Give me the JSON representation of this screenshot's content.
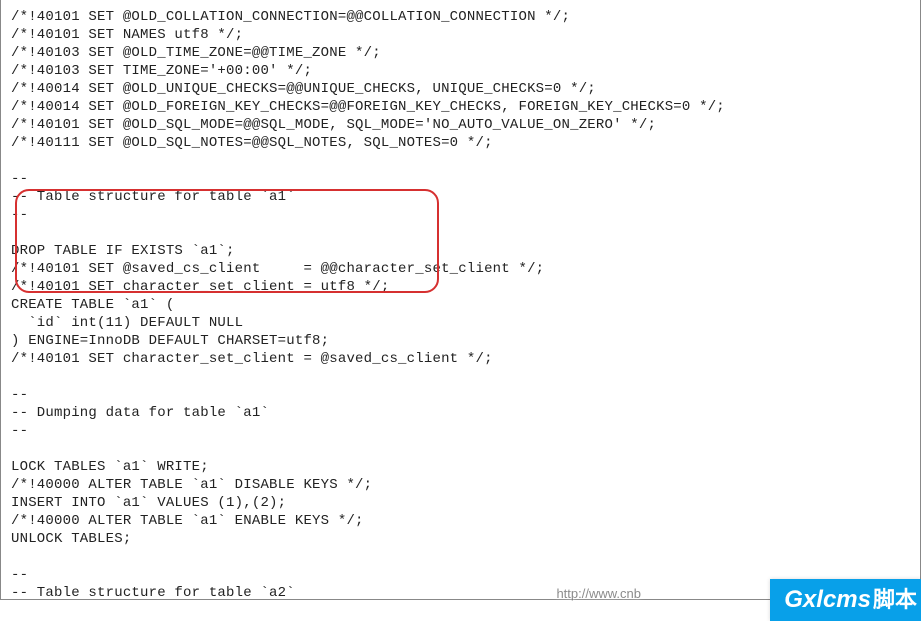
{
  "code_lines": [
    "/*!40101 SET @OLD_COLLATION_CONNECTION=@@COLLATION_CONNECTION */;",
    "/*!40101 SET NAMES utf8 */;",
    "/*!40103 SET @OLD_TIME_ZONE=@@TIME_ZONE */;",
    "/*!40103 SET TIME_ZONE='+00:00' */;",
    "/*!40014 SET @OLD_UNIQUE_CHECKS=@@UNIQUE_CHECKS, UNIQUE_CHECKS=0 */;",
    "/*!40014 SET @OLD_FOREIGN_KEY_CHECKS=@@FOREIGN_KEY_CHECKS, FOREIGN_KEY_CHECKS=0 */;",
    "/*!40101 SET @OLD_SQL_MODE=@@SQL_MODE, SQL_MODE='NO_AUTO_VALUE_ON_ZERO' */;",
    "/*!40111 SET @OLD_SQL_NOTES=@@SQL_NOTES, SQL_NOTES=0 */;",
    "",
    "--",
    "-- Table structure for table `a1`",
    "--",
    "",
    "DROP TABLE IF EXISTS `a1`;",
    "/*!40101 SET @saved_cs_client     = @@character_set_client */;",
    "/*!40101 SET character_set_client = utf8 */;",
    "CREATE TABLE `a1` (",
    "  `id` int(11) DEFAULT NULL",
    ") ENGINE=InnoDB DEFAULT CHARSET=utf8;",
    "/*!40101 SET character_set_client = @saved_cs_client */;",
    "",
    "--",
    "-- Dumping data for table `a1`",
    "--",
    "",
    "LOCK TABLES `a1` WRITE;",
    "/*!40000 ALTER TABLE `a1` DISABLE KEYS */;",
    "INSERT INTO `a1` VALUES (1),(2);",
    "/*!40000 ALTER TABLE `a1` ENABLE KEYS */;",
    "UNLOCK TABLES;",
    "",
    "--",
    "-- Table structure for table `a2`"
  ],
  "watermark": {
    "url_text": "http://www.cnb"
  },
  "logo": {
    "en": "Gxlcms",
    "cn": "脚本"
  }
}
